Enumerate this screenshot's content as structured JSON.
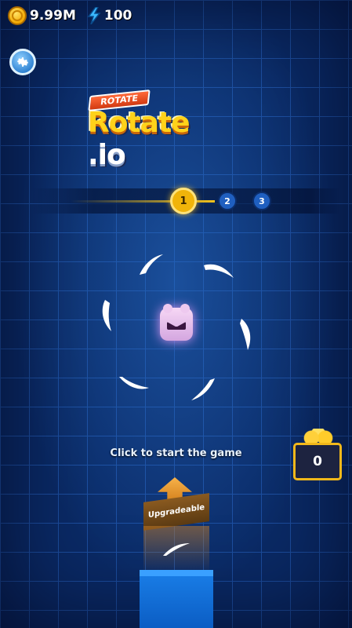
{
  "hud": {
    "coins_value": "9.99M",
    "energy_value": "100",
    "coin_icon": "gold-coin-icon",
    "energy_icon": "lightning-bolt-icon"
  },
  "settings": {
    "icon": "gear-icon"
  },
  "logo": {
    "banner": "ROTATE",
    "title": "Rotate",
    "suffix": ".io"
  },
  "levels": {
    "current": "1",
    "next": [
      "2",
      "3"
    ]
  },
  "prompt": "Click to start the game",
  "treasure": {
    "count": "0"
  },
  "upgrade": {
    "label": "Upgradeable"
  },
  "colors": {
    "background": "#0a2a66",
    "grid": "#1c4d9e",
    "accent_gold": "#f0b40a",
    "pedestal": "#0b5dc4"
  }
}
